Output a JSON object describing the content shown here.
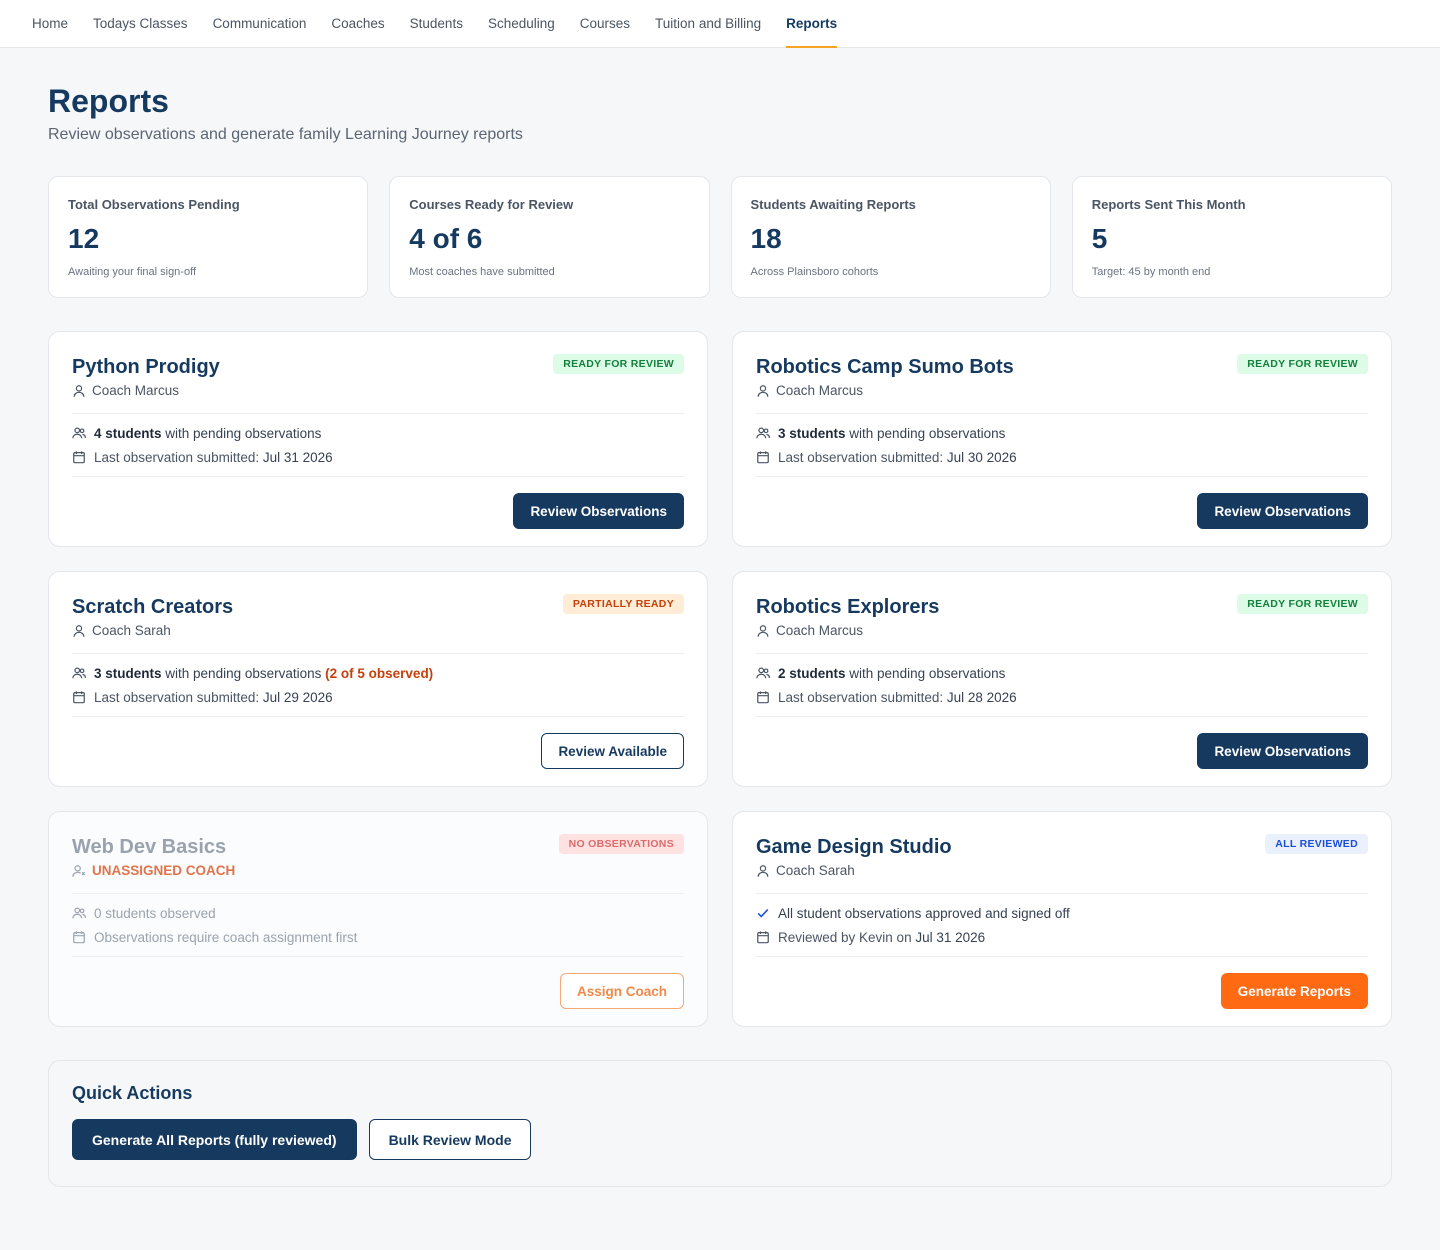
{
  "nav": {
    "items": [
      "Home",
      "Todays Classes",
      "Communication",
      "Coaches",
      "Students",
      "Scheduling",
      "Courses",
      "Tuition and Billing",
      "Reports"
    ],
    "active": "Reports"
  },
  "header": {
    "title": "Reports",
    "subtitle": "Review observations and generate family Learning Journey reports"
  },
  "stats": [
    {
      "label": "Total Observations Pending",
      "value": "12",
      "note": "Awaiting your final sign-off"
    },
    {
      "label": "Courses Ready for Review",
      "value": "4 of 6",
      "note": "Most coaches have submitted"
    },
    {
      "label": "Students Awaiting Reports",
      "value": "18",
      "note": "Across Plainsboro cohorts"
    },
    {
      "label": "Reports Sent This Month",
      "value": "5",
      "note": "Target: 45 by month end"
    }
  ],
  "courses": [
    {
      "title": "Python Prodigy",
      "badge": "READY FOR REVIEW",
      "coach": "Coach Marcus",
      "students_count": "4 students",
      "students_text": "with pending observations",
      "last_label": "Last observation submitted:",
      "last_date": "Jul 31 2026",
      "button": "Review Observations"
    },
    {
      "title": "Robotics Camp Sumo Bots",
      "badge": "READY FOR REVIEW",
      "coach": "Coach Marcus",
      "students_count": "3 students",
      "students_text": "with pending observations",
      "last_label": "Last observation submitted:",
      "last_date": "Jul 30 2026",
      "button": "Review Observations"
    },
    {
      "title": "Scratch Creators",
      "badge": "PARTIALLY READY",
      "coach": "Coach Sarah",
      "students_count": "3 students",
      "students_text": "with pending observations",
      "students_extra": "(2 of 5 observed)",
      "last_label": "Last observation submitted:",
      "last_date": "Jul 29 2026",
      "button": "Review Available"
    },
    {
      "title": "Robotics Explorers",
      "badge": "READY FOR REVIEW",
      "coach": "Coach Marcus",
      "students_count": "2 students",
      "students_text": "with pending observations",
      "last_label": "Last observation submitted:",
      "last_date": "Jul 28 2026",
      "button": "Review Observations"
    },
    {
      "title": "Web Dev Basics",
      "badge": "NO OBSERVATIONS",
      "coach": "UNASSIGNED COACH",
      "students_text": "0 students observed",
      "last_label": "Observations require coach assignment first",
      "button": "Assign Coach"
    },
    {
      "title": "Game Design Studio",
      "badge": "ALL REVIEWED",
      "coach": "Coach Sarah",
      "students_text": "All student observations approved and signed off",
      "last_label": "Reviewed by Kevin on",
      "last_date": "Jul 31 2026",
      "button": "Generate Reports"
    }
  ],
  "quick_actions": {
    "title": "Quick Actions",
    "generate_all": "Generate All Reports (fully reviewed)",
    "bulk_review": "Bulk Review Mode"
  },
  "colors": {
    "primary": "#163a5f",
    "accent": "#ff6a13",
    "tab_underline": "#f5a524",
    "ready": "#15803d",
    "partial": "#c2410c"
  }
}
